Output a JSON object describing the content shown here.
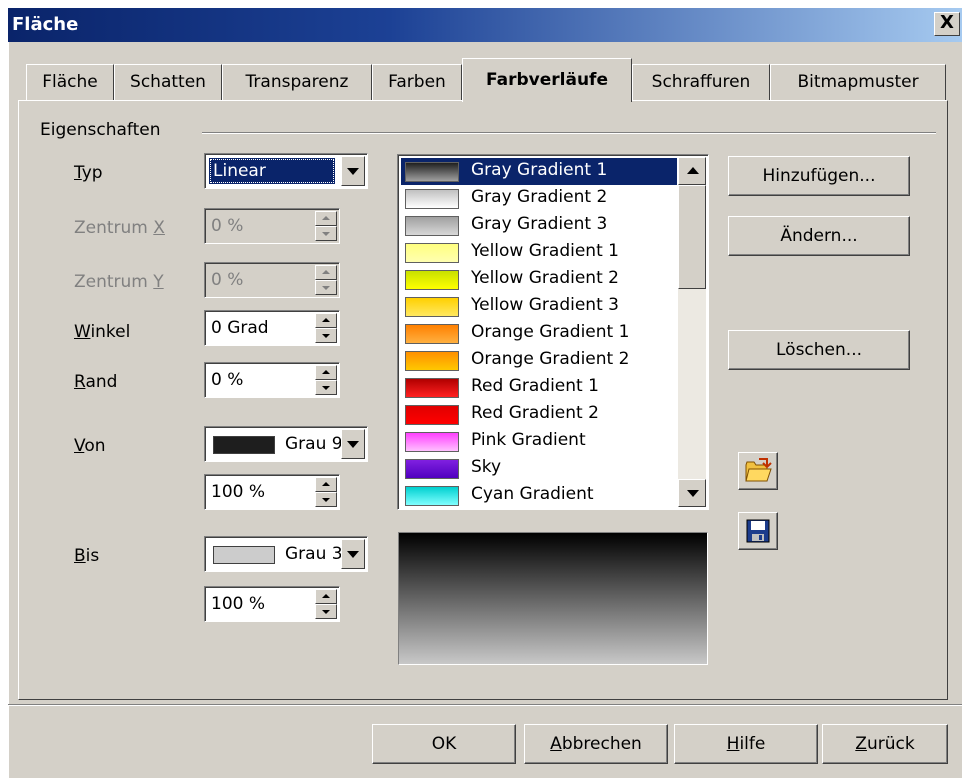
{
  "window": {
    "title": "Fläche",
    "close_label": "X"
  },
  "tabs": [
    {
      "label": "Fläche"
    },
    {
      "label": "Schatten"
    },
    {
      "label": "Transparenz"
    },
    {
      "label": "Farben"
    },
    {
      "label": "Farbverläufe",
      "active": true
    },
    {
      "label": "Schraffuren"
    },
    {
      "label": "Bitmapmuster"
    }
  ],
  "properties": {
    "group_label": "Eigenschaften",
    "typ": {
      "label": "Typ",
      "value": "Linear"
    },
    "zentrum_x": {
      "label": "Zentrum X",
      "value": "0 %"
    },
    "zentrum_y": {
      "label": "Zentrum Y",
      "value": "0 %"
    },
    "winkel": {
      "label": "Winkel",
      "value": "0 Grad"
    },
    "rand": {
      "label": "Rand",
      "value": "0 %"
    },
    "von": {
      "label": "Von",
      "color": "Grau 9",
      "swatch": "#1e1e1e",
      "intensity": "100 %"
    },
    "bis": {
      "label": "Bis",
      "color": "Grau 3",
      "swatch": "#cccccc",
      "intensity": "100 %"
    }
  },
  "gradients": [
    {
      "name": "Gray Gradient 1",
      "from": "#202020",
      "to": "#a0a0a0",
      "selected": true
    },
    {
      "name": "Gray Gradient 2",
      "from": "#c0c0c0",
      "to": "#ffffff"
    },
    {
      "name": "Gray Gradient 3",
      "from": "#a0a0a0",
      "to": "#d8d8d8"
    },
    {
      "name": "Yellow Gradient 1",
      "from": "#ffff80",
      "to": "#ffffb0"
    },
    {
      "name": "Yellow Gradient 2",
      "from": "#c8e000",
      "to": "#ffff00"
    },
    {
      "name": "Yellow Gradient 3",
      "from": "#ffd000",
      "to": "#ffe860"
    },
    {
      "name": "Orange Gradient 1",
      "from": "#ff8000",
      "to": "#ffb040"
    },
    {
      "name": "Orange Gradient 2",
      "from": "#ff9000",
      "to": "#ffc800"
    },
    {
      "name": "Red Gradient 1",
      "from": "#b00000",
      "to": "#ff2020"
    },
    {
      "name": "Red Gradient 2",
      "from": "#e00000",
      "to": "#ff0000"
    },
    {
      "name": "Pink Gradient",
      "from": "#ff40ff",
      "to": "#ffc0ff"
    },
    {
      "name": "Sky",
      "from": "#8020e0",
      "to": "#5000c0"
    },
    {
      "name": "Cyan Gradient",
      "from": "#00d0d0",
      "to": "#80ffff"
    }
  ],
  "actions": {
    "add": "Hinzufügen...",
    "modify": "Ändern...",
    "delete": "Löschen..."
  },
  "preview": {
    "from": "#000000",
    "to": "#c8c8c8"
  },
  "footer": {
    "ok": "OK",
    "cancel": "Abbrechen",
    "help": "Hilfe",
    "back": "Zurück"
  }
}
